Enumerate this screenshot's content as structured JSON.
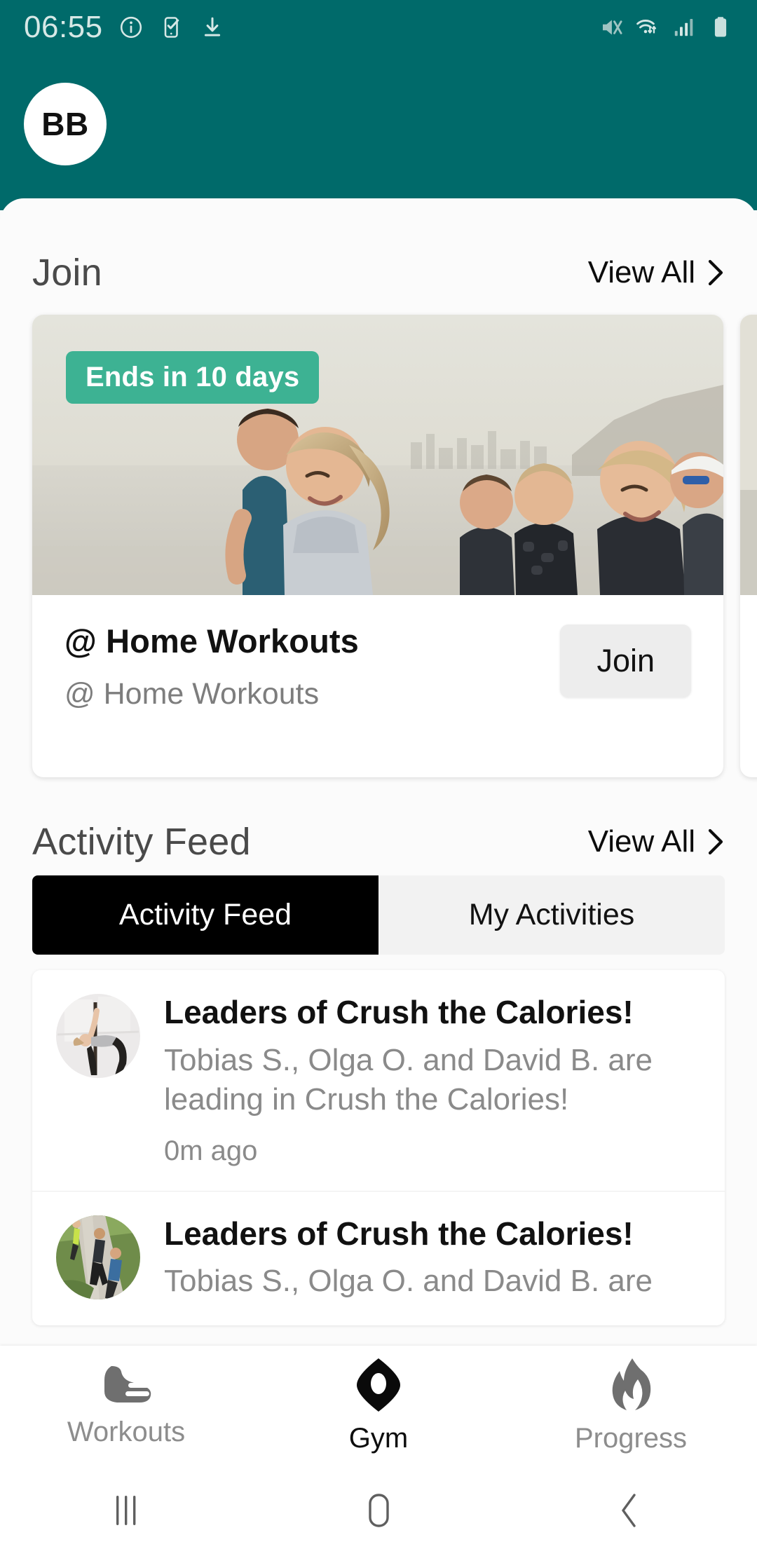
{
  "status_bar": {
    "time": "06:55",
    "left_icons": [
      "info-icon",
      "phone-check-icon",
      "download-icon"
    ],
    "right_icons": [
      "mute-icon",
      "wifi-icon",
      "signal-icon",
      "battery-icon"
    ],
    "background_color": "#006A6A",
    "icon_color": "#d6e8e6"
  },
  "header": {
    "avatar_initials": "BB"
  },
  "join_section": {
    "title": "Join",
    "view_all_label": "View All",
    "cards": [
      {
        "badge": "Ends in 10 days",
        "title": "@ Home Workouts",
        "subtitle": "@ Home Workouts",
        "action_label": "Join",
        "badge_color": "#3DB293"
      }
    ]
  },
  "activity_section": {
    "title": "Activity Feed",
    "view_all_label": "View All",
    "tabs": [
      {
        "label": "Activity Feed",
        "active": true
      },
      {
        "label": "My Activities",
        "active": false
      }
    ],
    "items": [
      {
        "title": "Leaders of Crush the Calories!",
        "body": "Tobias S., Olga O. and David B. are leading in Crush the Calories!",
        "time": "0m ago",
        "avatar": "yoga-pose-photo"
      },
      {
        "title": "Leaders of Crush the Calories!",
        "body": "Tobias S., Olga O. and David B. are",
        "time": "",
        "avatar": "outdoor-runners-photo"
      }
    ]
  },
  "bottom_nav": {
    "items": [
      {
        "label": "Workouts",
        "icon": "shoe-icon",
        "active": false
      },
      {
        "label": "Gym",
        "icon": "gym-marker-icon",
        "active": true
      },
      {
        "label": "Progress",
        "icon": "flame-icon",
        "active": false
      }
    ]
  },
  "system_nav": {
    "items": [
      {
        "icon": "recents-icon"
      },
      {
        "icon": "home-icon"
      },
      {
        "icon": "back-icon"
      }
    ]
  }
}
